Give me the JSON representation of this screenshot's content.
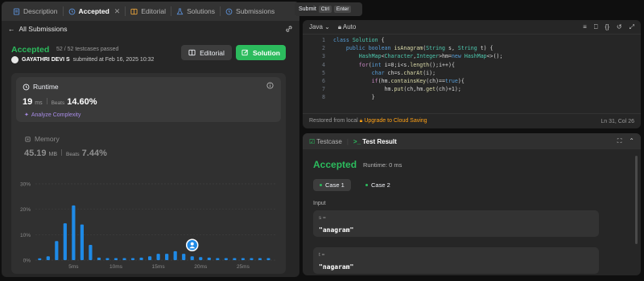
{
  "tabs": [
    {
      "label": "Description",
      "icon": "description-icon",
      "active": false
    },
    {
      "label": "Accepted",
      "icon": "history-icon",
      "active": true,
      "closable": true
    },
    {
      "label": "Editorial",
      "icon": "book-icon",
      "active": false
    },
    {
      "label": "Solutions",
      "icon": "flask-icon",
      "active": false
    },
    {
      "label": "Submissions",
      "icon": "history-icon",
      "active": false
    }
  ],
  "subbar": {
    "back_label": "All Submissions"
  },
  "submission": {
    "status": "Accepted",
    "testcases": "52 / 52 testcases passed",
    "user": "GAYATHRI DEVI S",
    "submitted_text": "submitted at Feb 16, 2025 10:32",
    "editorial_label": "Editorial",
    "solution_label": "Solution"
  },
  "runtime": {
    "label": "Runtime",
    "value": "19",
    "unit": "ms",
    "beats_label": "Beats",
    "beats_value": "14.60%",
    "analyze_label": "Analyze Complexity"
  },
  "memory": {
    "label": "Memory",
    "value": "45.19",
    "unit": "MB",
    "beats_label": "Beats",
    "beats_value": "7.44%"
  },
  "chart_data": {
    "type": "bar",
    "title": "",
    "xlabel": "",
    "ylabel": "",
    "ylim": [
      0,
      30
    ],
    "yticks": [
      "30%",
      "20%",
      "10%",
      "0%"
    ],
    "ytick_values": [
      30,
      20,
      10,
      0
    ],
    "xticks": [
      {
        "label": "5ms",
        "x": 5
      },
      {
        "label": "10ms",
        "x": 10
      },
      {
        "label": "15ms",
        "x": 15
      },
      {
        "label": "20ms",
        "x": 20
      },
      {
        "label": "25ms",
        "x": 25
      }
    ],
    "x": [
      1,
      2,
      3,
      4,
      5,
      6,
      7,
      8,
      9,
      10,
      11,
      12,
      13,
      14,
      15,
      16,
      17,
      18,
      19,
      20,
      21,
      22,
      23,
      24,
      25,
      26,
      27,
      28
    ],
    "values": [
      0.7,
      1.5,
      7.5,
      14.5,
      21.5,
      14,
      6,
      1,
      0.8,
      0.8,
      0.8,
      0.8,
      1,
      1.5,
      2.5,
      2.5,
      3.5,
      2.5,
      1.5,
      1.2,
      1,
      0.8,
      0.8,
      0.8,
      0.8,
      0.8,
      0.8,
      0.8
    ],
    "highlight_x": 19,
    "bar_color": "#1f8ae6",
    "grid": true
  },
  "submit_pill": {
    "label": "Submit",
    "key1": "Ctrl",
    "key2": "Enter"
  },
  "editor": {
    "language": "Java",
    "autocomplete": "Auto",
    "status_left": "Restored from local",
    "upgrade": "Upgrade to Cloud Saving",
    "cursor": "Ln 31, Col 26",
    "lines": [
      {
        "n": "1",
        "tokens": [
          [
            "kw",
            "class "
          ],
          [
            "ty",
            "Solution "
          ],
          [
            "pu",
            "{"
          ]
        ]
      },
      {
        "n": "2",
        "tokens": [
          [
            "pu",
            "    "
          ],
          [
            "kw",
            "public "
          ],
          [
            "kw",
            "boolean "
          ],
          [
            "fn",
            "isAnagram"
          ],
          [
            "pu",
            "("
          ],
          [
            "ty",
            "String "
          ],
          [
            "pu",
            "s, "
          ],
          [
            "ty",
            "String "
          ],
          [
            "pu",
            "t) {"
          ]
        ]
      },
      {
        "n": "3",
        "tokens": [
          [
            "pu",
            "        "
          ],
          [
            "ty",
            "HashMap"
          ],
          [
            "pu",
            "<"
          ],
          [
            "ty",
            "Character"
          ],
          [
            "pu",
            ","
          ],
          [
            "ty",
            "Integer"
          ],
          [
            "pu",
            ">hm="
          ],
          [
            "kw",
            "new "
          ],
          [
            "ty",
            "HashMap"
          ],
          [
            "pu",
            "<>();"
          ]
        ]
      },
      {
        "n": "4",
        "tokens": [
          [
            "pu",
            "        "
          ],
          [
            "kw2",
            "for"
          ],
          [
            "pu",
            "("
          ],
          [
            "kw",
            "int "
          ],
          [
            "pu",
            "i=0;i<s."
          ],
          [
            "fn",
            "length"
          ],
          [
            "pu",
            "();i++){"
          ]
        ]
      },
      {
        "n": "5",
        "tokens": [
          [
            "pu",
            "            "
          ],
          [
            "kw",
            "char "
          ],
          [
            "pu",
            "ch=s."
          ],
          [
            "fn",
            "charAt"
          ],
          [
            "pu",
            "(i);"
          ]
        ]
      },
      {
        "n": "6",
        "tokens": [
          [
            "pu",
            "            "
          ],
          [
            "kw2",
            "if"
          ],
          [
            "pu",
            "(hm."
          ],
          [
            "fn",
            "containsKey"
          ],
          [
            "pu",
            "(ch)=="
          ],
          [
            "kw",
            "true"
          ],
          [
            "pu",
            "){"
          ]
        ]
      },
      {
        "n": "7",
        "tokens": [
          [
            "pu",
            "                hm."
          ],
          [
            "fn",
            "put"
          ],
          [
            "pu",
            "(ch,hm."
          ],
          [
            "fn",
            "get"
          ],
          [
            "pu",
            "(ch)+1);"
          ]
        ]
      },
      {
        "n": "8",
        "tokens": [
          [
            "pu",
            "            }"
          ]
        ]
      }
    ]
  },
  "result": {
    "testcase_tab": "Testcase",
    "result_tab": "Test Result",
    "status": "Accepted",
    "runtime": "Runtime: 0 ms",
    "cases": [
      "Case 1",
      "Case 2"
    ],
    "input_label": "Input",
    "inputs": [
      {
        "var": "s =",
        "value": "\"anagram\""
      },
      {
        "var": "t =",
        "value": "\"nagaram\""
      }
    ]
  }
}
